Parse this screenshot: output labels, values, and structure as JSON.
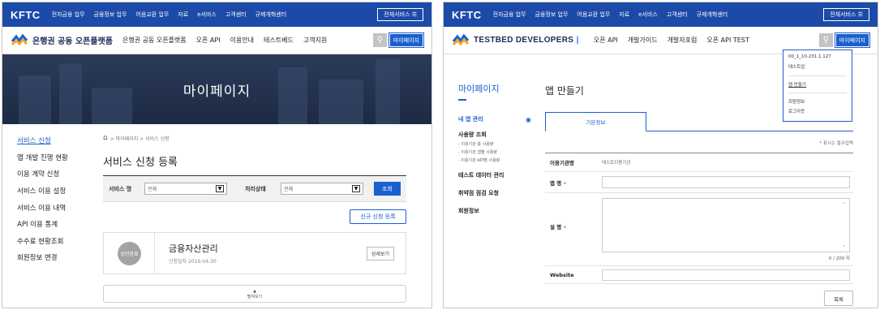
{
  "left": {
    "topbar": {
      "logo": "KFTC",
      "menu": [
        "전자금융 업무",
        "금융정보 업무",
        "어음교환 업무",
        "자료",
        "e서비스",
        "고객센터",
        "규제개혁센터"
      ],
      "all_services": "전체서비스 ☰"
    },
    "nav": {
      "brand": "은행권 공동 오픈플랫폼",
      "items": [
        "은행권 공동 오픈플랫폼",
        "오픈 API",
        "이용안내",
        "테스트베드",
        "고객지원"
      ],
      "mypage": "마이페이지"
    },
    "hero_title": "마이페이지",
    "sidebar": [
      "서비스 신청",
      "앱 개발 진행 현황",
      "이용 계약 신청",
      "서비스 이용 설정",
      "서비스 이용 내역",
      "API 이용 통계",
      "수수료 현황조회",
      "회원정보 변경"
    ],
    "breadcrumb": "> 마이페이지 > 서비스 신청",
    "page_title": "서비스 신청 등록",
    "filter": {
      "service_label": "서비스 명",
      "service_value": "전체",
      "status_label": "처리상태",
      "status_value": "전체",
      "search_btn": "조회"
    },
    "new_btn": "신규 신청 등록",
    "card": {
      "badge": "승인완료",
      "name": "금융자산관리",
      "date": "신청일자 2016-04-30",
      "detail": "상세보기"
    },
    "more": "펼쳐보기"
  },
  "right": {
    "topbar": {
      "logo": "KFTC",
      "menu": [
        "전자금융 업무",
        "금융정보 업무",
        "어음교환 업무",
        "자료",
        "e서비스",
        "고객센터",
        "규제개혁센터"
      ],
      "all_services": "전체서비스 ☰"
    },
    "nav": {
      "brand": "TESTBED DEVELOPERS",
      "items": [
        "오픈 API",
        "개발가이드",
        "개발자포럼",
        "오픈 API TEST"
      ],
      "mypage": "마이페이지"
    },
    "dropdown": {
      "ip": "00_1_10.231.1.127",
      "user": "테스트업",
      "items": [
        "앱 만들기",
        "회원정보",
        "로그아웃"
      ]
    },
    "sidebar": {
      "title": "마이페이지",
      "items": [
        {
          "label": "내 앱 관리",
          "sub": []
        },
        {
          "label": "사용량 조회",
          "sub": [
            "- 이용기관 총 사용량",
            "- 이용기관 앱별 사용량",
            "- 이용기관 API별 사용량"
          ]
        },
        {
          "label": "테스트 데이터 관리",
          "sub": []
        },
        {
          "label": "취약점 점검 요청",
          "sub": []
        },
        {
          "label": "회원정보",
          "sub": []
        }
      ]
    },
    "page_title": "앱 만들기",
    "tab": "기본정보",
    "required_note": "* 표시는 필수입력",
    "form": {
      "org_label": "이용기관명",
      "org_value": "테스트이용기관",
      "app_label": "앱 명",
      "desc_label": "설 명",
      "counter": "0 / 200 자",
      "website_label": "Website"
    },
    "list_btn": "목록"
  }
}
